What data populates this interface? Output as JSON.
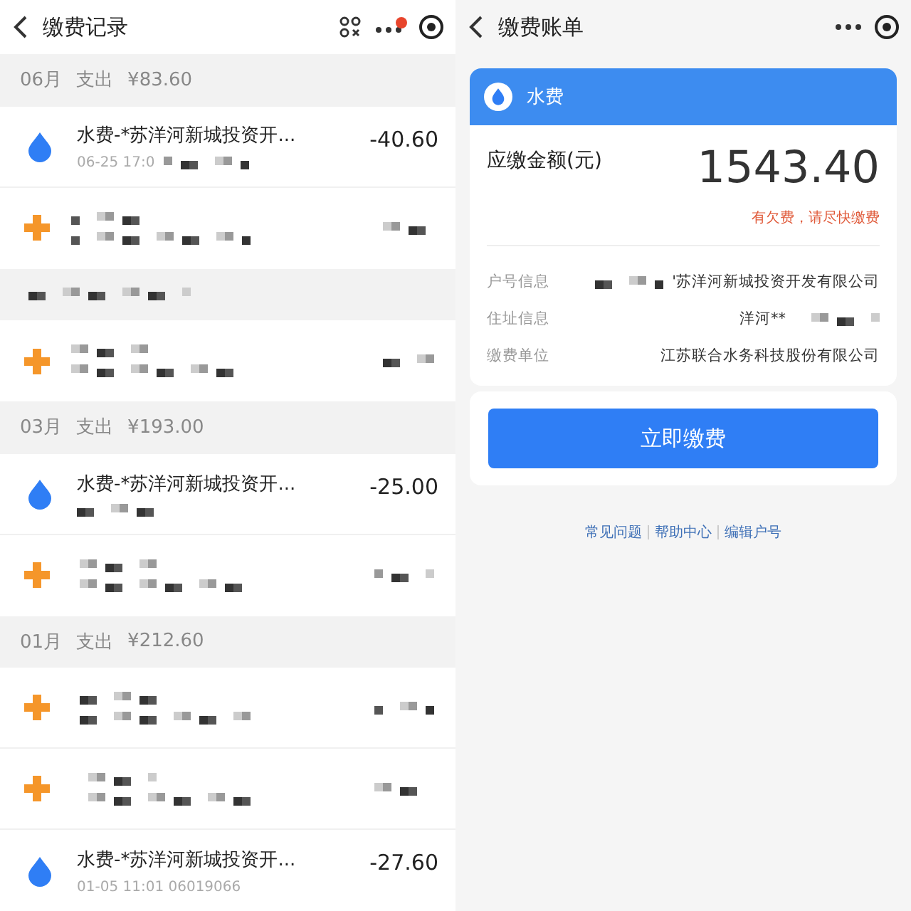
{
  "left": {
    "header": {
      "title": "缴费记录"
    },
    "sections": [
      {
        "kind": "month",
        "month": "06月",
        "label": "支出",
        "total": "¥83.60",
        "items": [
          {
            "kind": "water",
            "title": "水费-*苏洋河新城投资开...",
            "time": "06-25 17:0",
            "amount": "-40.60"
          },
          {
            "kind": "other"
          }
        ]
      },
      {
        "kind": "hidden",
        "items": [
          {
            "kind": "other"
          }
        ]
      },
      {
        "kind": "month",
        "month": "03月",
        "label": "支出",
        "total": "¥193.00",
        "items": [
          {
            "kind": "water",
            "title": "水费-*苏洋河新城投资开...",
            "amount": "-25.00"
          },
          {
            "kind": "other"
          }
        ]
      },
      {
        "kind": "month",
        "month": "01月",
        "label": "支出",
        "total": "¥212.60",
        "items": [
          {
            "kind": "other"
          },
          {
            "kind": "other"
          },
          {
            "kind": "water",
            "title": "水费-*苏洋河新城投资开...",
            "time": "01-05 11:01 06019066",
            "amount": "-27.60"
          }
        ]
      }
    ]
  },
  "right": {
    "header": {
      "title": "缴费账单"
    },
    "bill": {
      "type": "水费",
      "amount_label": "应缴金额(元)",
      "amount": "1543.40",
      "notice": "有欠费，请尽快缴费",
      "rows": [
        {
          "label": "户号信息",
          "value": "'苏洋河新城投资开发有限公司",
          "masked": true
        },
        {
          "label": "住址信息",
          "value": "洋河**",
          "masked": true
        },
        {
          "label": "缴费单位",
          "value": "江苏联合水务科技股份有限公司",
          "masked": false
        }
      ]
    },
    "pay_button": "立即缴费",
    "links": [
      "常见问题",
      "帮助中心",
      "编辑户号"
    ]
  }
}
